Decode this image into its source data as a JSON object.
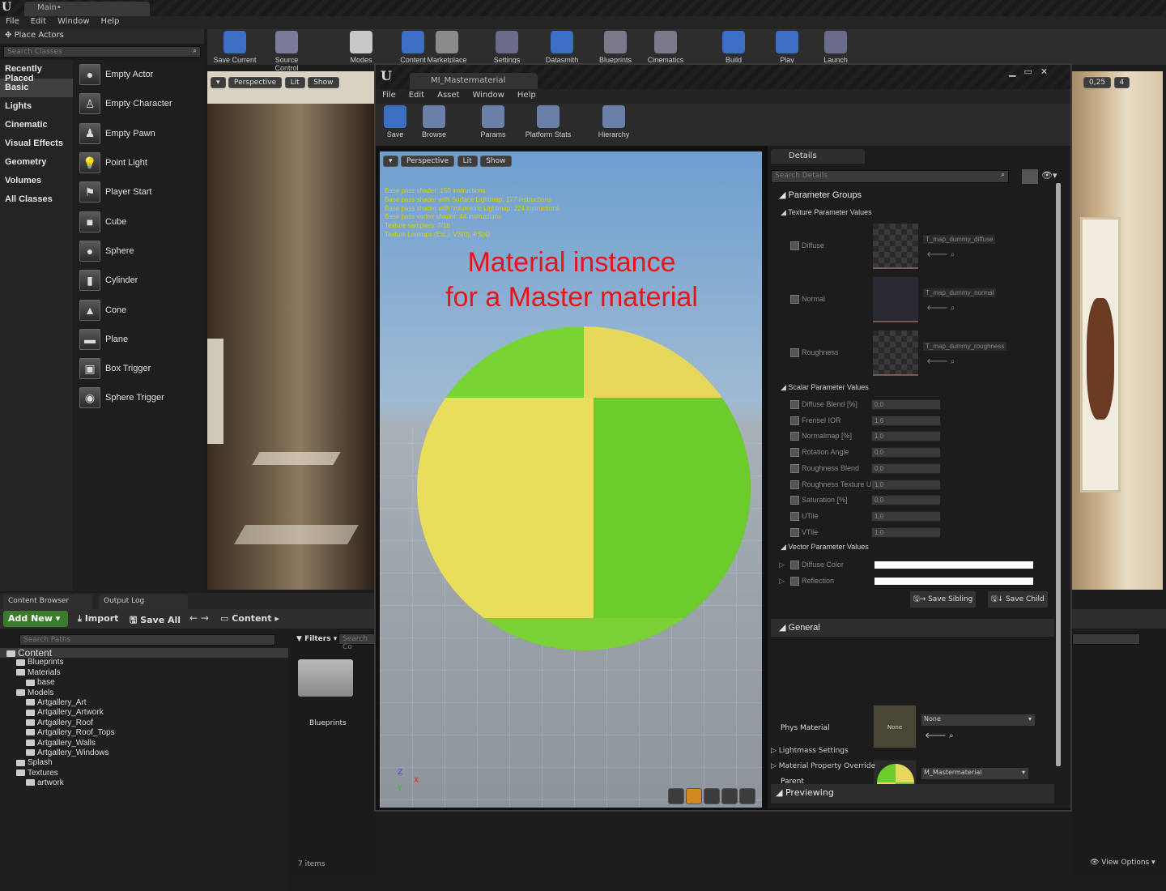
{
  "editor": {
    "tab_title": "Main•",
    "menu": [
      "File",
      "Edit",
      "Window",
      "Help"
    ],
    "panel_title": "Place Actors",
    "search_placeholder": "Search Classes"
  },
  "categories": [
    "Recently Placed",
    "Basic",
    "Lights",
    "Cinematic",
    "Visual Effects",
    "Geometry",
    "Volumes",
    "All Classes"
  ],
  "selected_category": "Basic",
  "actors": [
    {
      "label": "Empty Actor",
      "icon": "sphere-icon"
    },
    {
      "label": "Empty Character",
      "icon": "character-icon"
    },
    {
      "label": "Empty Pawn",
      "icon": "pawn-icon"
    },
    {
      "label": "Point Light",
      "icon": "lightbulb-icon"
    },
    {
      "label": "Player Start",
      "icon": "player-start-icon"
    },
    {
      "label": "Cube",
      "icon": "cube-icon"
    },
    {
      "label": "Sphere",
      "icon": "sphere-icon"
    },
    {
      "label": "Cylinder",
      "icon": "cylinder-icon"
    },
    {
      "label": "Cone",
      "icon": "cone-icon"
    },
    {
      "label": "Plane",
      "icon": "plane-icon"
    },
    {
      "label": "Box Trigger",
      "icon": "box-trigger-icon"
    },
    {
      "label": "Sphere Trigger",
      "icon": "sphere-trigger-icon"
    }
  ],
  "toolbar": {
    "items": [
      "Save Current",
      "Source Control",
      "Modes",
      "Content",
      "Marketplace",
      "Settings",
      "Datasmith",
      "Blueprints",
      "Cinematics",
      "Build",
      "Play",
      "Launch"
    ]
  },
  "viewport": {
    "perspective": "Perspective",
    "lit": "Lit",
    "show": "Show",
    "zoom": "0,25",
    "cam_speed": "4"
  },
  "content_browser": {
    "tabs": [
      "Content Browser",
      "Output Log"
    ],
    "add_new": "Add New",
    "import": "Import",
    "save_all": "Save All",
    "path": "Content",
    "search_paths": "Search Paths",
    "filters": "Filters",
    "search_content": "Search Co",
    "tree": [
      {
        "label": "Content",
        "indent": 0
      },
      {
        "label": "Blueprints",
        "indent": 1
      },
      {
        "label": "Materials",
        "indent": 1
      },
      {
        "label": "base",
        "indent": 2
      },
      {
        "label": "Models",
        "indent": 1
      },
      {
        "label": "Artgallery_Art",
        "indent": 2
      },
      {
        "label": "Artgallery_Artwork",
        "indent": 2
      },
      {
        "label": "Artgallery_Roof",
        "indent": 2
      },
      {
        "label": "Artgallery_Roof_Tops",
        "indent": 2
      },
      {
        "label": "Artgallery_Walls",
        "indent": 2
      },
      {
        "label": "Artgallery_Windows",
        "indent": 2
      },
      {
        "label": "Splash",
        "indent": 1
      },
      {
        "label": "Textures",
        "indent": 1
      },
      {
        "label": "artwork",
        "indent": 2
      }
    ],
    "asset_label": "Blueprints",
    "item_count": "7 items",
    "view_options": "View Options"
  },
  "material_editor": {
    "tab_title": "MI_Mastermaterial",
    "menu": [
      "File",
      "Edit",
      "Asset",
      "Window",
      "Help"
    ],
    "toolbar": [
      "Save",
      "Browse",
      "Params",
      "Platform Stats",
      "Hierarchy"
    ],
    "viewport": {
      "perspective": "Perspective",
      "lit": "Lit",
      "show": "Show"
    },
    "stats": [
      "Base pass shader: 150 instructions",
      "Base pass shader with Surface Lightmap: 177 instructions",
      "Base pass shader with Volumetric Lightmap: 224 instructions",
      "Base pass vertex shader: 44 instructions",
      "Texture samplers: 7/16",
      "Texture Lookups (Est.): VS(0), PS(4)"
    ],
    "overlay_line1": "Material instance",
    "overlay_line2": "for a Master material"
  },
  "details": {
    "tab": "Details",
    "search_placeholder": "Search Details",
    "parameter_groups": "Parameter Groups",
    "texture_header": "Texture Parameter Values",
    "textures": [
      {
        "label": "Diffuse",
        "value": "T_map_dummy_diffuse"
      },
      {
        "label": "Normal",
        "value": "T_map_dummy_normal"
      },
      {
        "label": "Roughness",
        "value": "T_map_dummy_roughness"
      }
    ],
    "scalar_header": "Scalar Parameter Values",
    "scalars": [
      {
        "label": "Diffuse Blend [%]",
        "value": "0,0"
      },
      {
        "label": "Frensel IOR",
        "value": "1,6"
      },
      {
        "label": "Normalmap [%]",
        "value": "1,0"
      },
      {
        "label": "Rotation Angle",
        "value": "0,0"
      },
      {
        "label": "Roughness Blend",
        "value": "0,0"
      },
      {
        "label": "Roughness Texture U",
        "value": "1,0"
      },
      {
        "label": "Saturation [%]",
        "value": "0,0"
      },
      {
        "label": "UTile",
        "value": "1,0"
      },
      {
        "label": "VTile",
        "value": "1,0"
      }
    ],
    "vector_header": "Vector Parameter Values",
    "vectors": [
      {
        "label": "Diffuse Color"
      },
      {
        "label": "Reflection"
      }
    ],
    "save_sibling": "Save Sibling",
    "save_child": "Save Child",
    "general": "General",
    "phys_material_label": "Phys Material",
    "phys_material_value": "None",
    "phys_thumb": "None",
    "parent_label": "Parent",
    "parent_value": "M_Mastermaterial",
    "lightmass": "Lightmass Settings",
    "override": "Material Property Override",
    "previewing": "Previewing"
  },
  "colors": {
    "accent_red": "#e8141a",
    "green": "#6fd42a",
    "yellow": "#e8d95a",
    "stats_yellow": "#d9d400"
  }
}
